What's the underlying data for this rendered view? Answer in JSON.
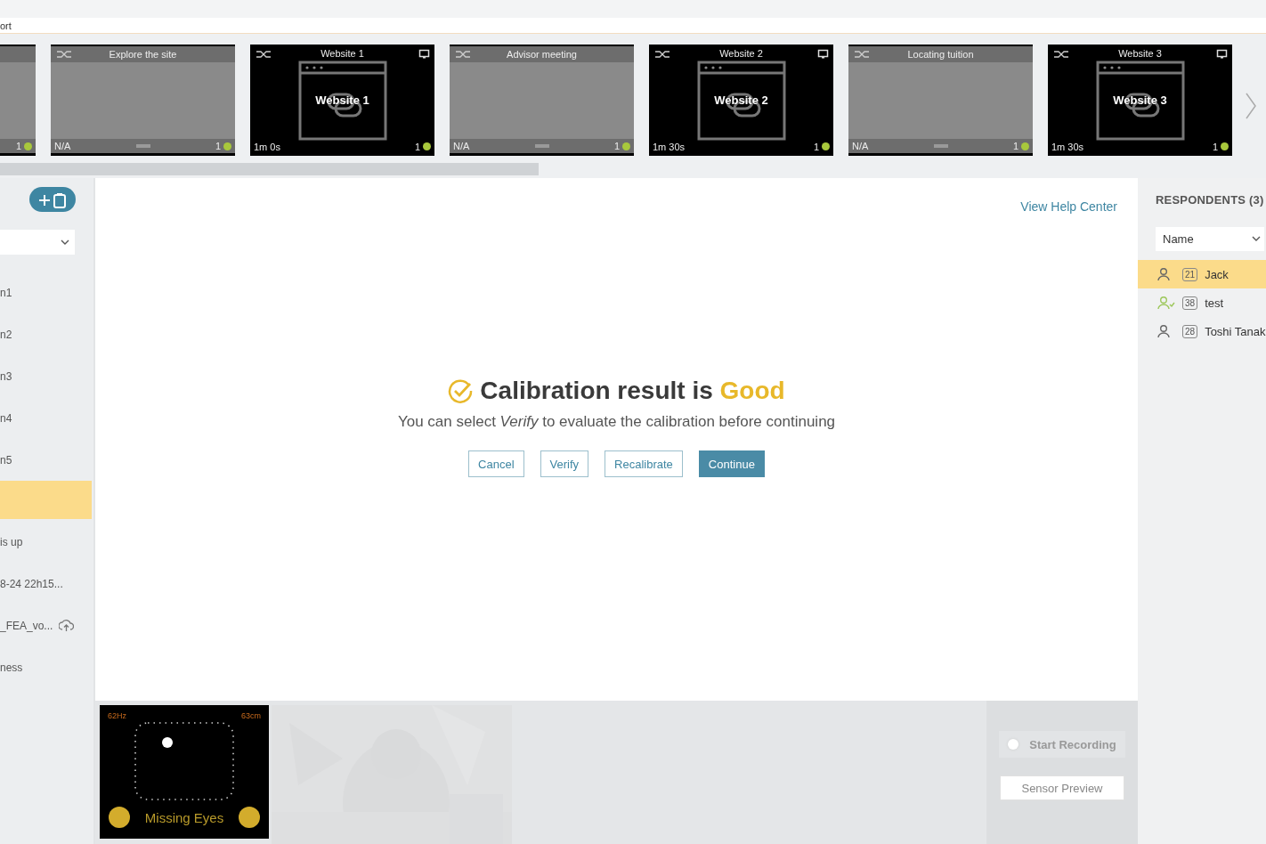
{
  "top_bar": {
    "text": "ort"
  },
  "stimuli": [
    {
      "kind": "text",
      "count": "1"
    },
    {
      "kind": "text",
      "title": "Explore the site",
      "duration": "N/A",
      "count": "1"
    },
    {
      "kind": "web",
      "title": "Website 1",
      "label": "Website 1",
      "duration": "1m 0s",
      "count": "1"
    },
    {
      "kind": "text",
      "title": "Advisor meeting",
      "duration": "N/A",
      "count": "1"
    },
    {
      "kind": "web",
      "title": "Website 2",
      "label": "Website 2",
      "duration": "1m 30s",
      "count": "1"
    },
    {
      "kind": "text",
      "title": "Locating tuition",
      "duration": "N/A",
      "count": "1"
    },
    {
      "kind": "web",
      "title": "Website 3",
      "label": "Website 3",
      "duration": "1m 30s",
      "count": "1"
    }
  ],
  "sidebar": {
    "items": [
      {
        "kind": "plain",
        "label": "n1",
        "selected": false
      },
      {
        "kind": "plain",
        "label": "n2",
        "selected": false
      },
      {
        "kind": "plain",
        "label": "n3",
        "selected": false
      },
      {
        "kind": "plain",
        "label": "n4",
        "selected": false
      },
      {
        "kind": "plain",
        "label": "n5",
        "selected": false
      },
      {
        "kind": "plain",
        "selected": true
      },
      {
        "kind": "plain",
        "label": "is up",
        "selected": false
      },
      {
        "kind": "plain",
        "label": "8-24 22h15...",
        "selected": false
      },
      {
        "kind": "upload",
        "label": "_FEA_vo...",
        "selected": false
      },
      {
        "kind": "plain",
        "label": "ness",
        "selected": false
      }
    ]
  },
  "dialog": {
    "help_link": "View Help Center",
    "title": "Calibration result is **Good**",
    "message": "You can select *Verify* to evaluate the calibration before continuing",
    "buttons": [
      {
        "label": "Cancel",
        "primary": false
      },
      {
        "label": "Verify",
        "primary": false
      },
      {
        "label": "Recalibrate",
        "primary": false
      },
      {
        "label": "Continue",
        "primary": true
      }
    ]
  },
  "sensor": {
    "rate": "62Hz",
    "distance": "63cm",
    "status": "Missing Eyes"
  },
  "recording": {
    "start_label": "Start Recording",
    "disabled": true,
    "preview_button": "Sensor Preview"
  },
  "respondents": {
    "title": "RESPONDENTS (3)",
    "sort": "Name",
    "items": [
      {
        "age": "21",
        "name": "Jack",
        "selected": true,
        "verified": false
      },
      {
        "age": "38",
        "name": "test",
        "selected": false,
        "verified": true
      },
      {
        "age": "28",
        "name": "Toshi Tanak",
        "selected": false,
        "verified": false
      }
    ]
  }
}
